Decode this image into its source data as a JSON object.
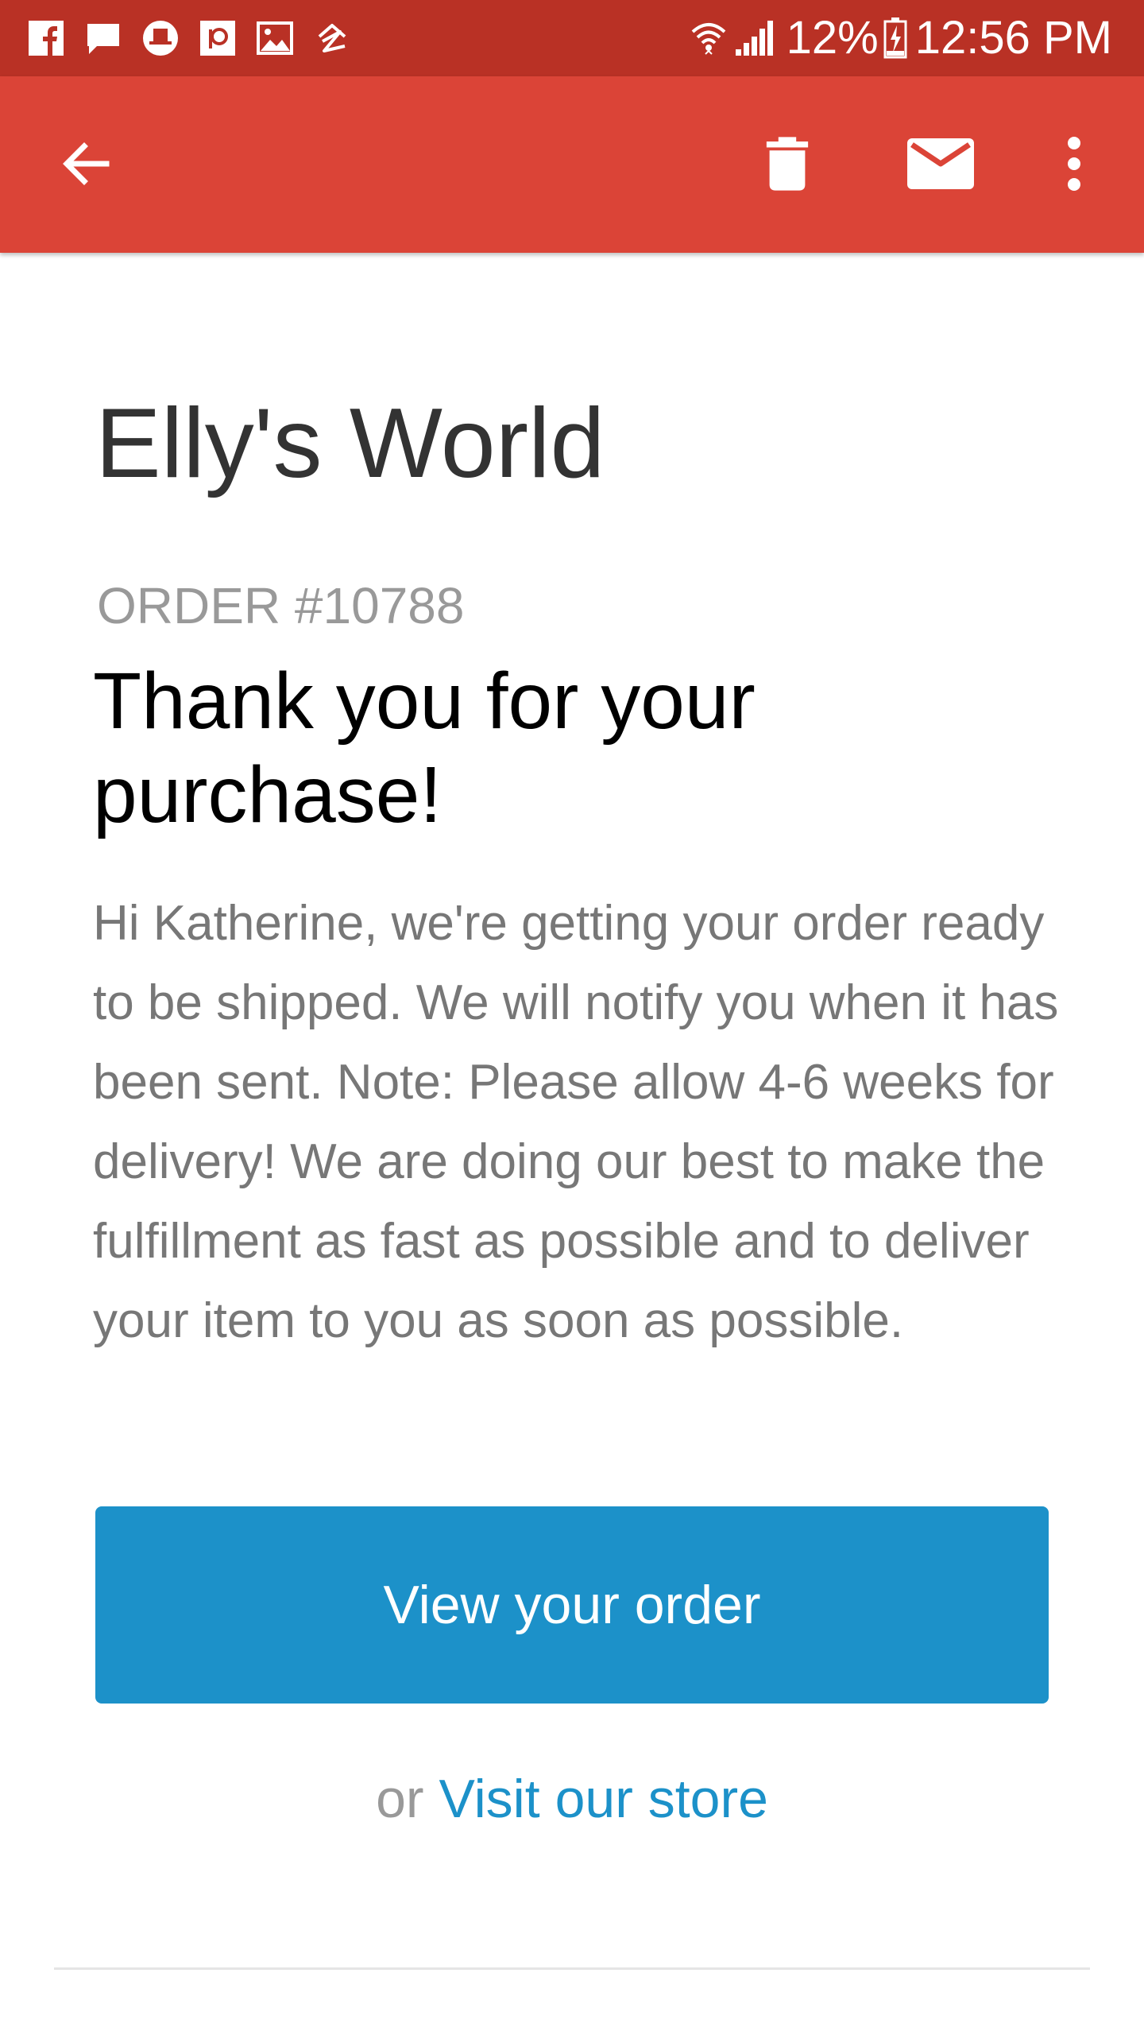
{
  "status_bar": {
    "notification_icons": [
      "facebook-icon",
      "chat-icon",
      "tophat-app-icon",
      "patreon-icon",
      "gallery-icon",
      "zillow-icon"
    ],
    "wifi_icon": "wifi-icon",
    "signal_icon": "signal-bars-icon",
    "battery_text": "12%",
    "battery_icon": "battery-charging-icon",
    "time": "12:56 PM",
    "background_color": "#b93125"
  },
  "app_bar": {
    "back_icon": "arrow-back-icon",
    "delete_icon": "trash-icon",
    "mark_unread_icon": "envelope-icon",
    "more_icon": "more-vertical-icon",
    "background_color": "#db4437"
  },
  "email": {
    "shop_name": "Elly's World",
    "order_number": "ORDER #10788",
    "headline": "Thank you for your purchase!",
    "message": "Hi Katherine, we're getting your order ready to be shipped. We will notify you when it has been sent. Note: Please allow 4-6 weeks for delivery! We are doing our best to make the fulfillment as fast as possible and to deliver your item to you as soon as possible.",
    "view_order_label": "View your order",
    "or_text": "or",
    "visit_store_label": "Visit our store",
    "accent_color": "#1c91c9"
  }
}
